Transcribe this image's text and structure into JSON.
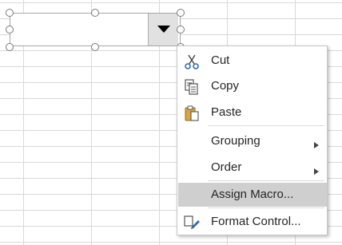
{
  "menu": {
    "items": [
      {
        "label": "Cut",
        "icon": "scissors-icon"
      },
      {
        "label": "Copy",
        "icon": "copy-icon"
      },
      {
        "label": "Paste",
        "icon": "paste-icon"
      },
      {
        "label": "Grouping",
        "submenu": true
      },
      {
        "label": "Order",
        "submenu": true
      },
      {
        "label": "Assign Macro...",
        "highlighted": true
      },
      {
        "label": "Format Control...",
        "icon": "format-control-icon"
      }
    ]
  },
  "colors": {
    "highlight": "#cfcfcf",
    "gridline": "#d9d9d9",
    "text": "#262626"
  }
}
